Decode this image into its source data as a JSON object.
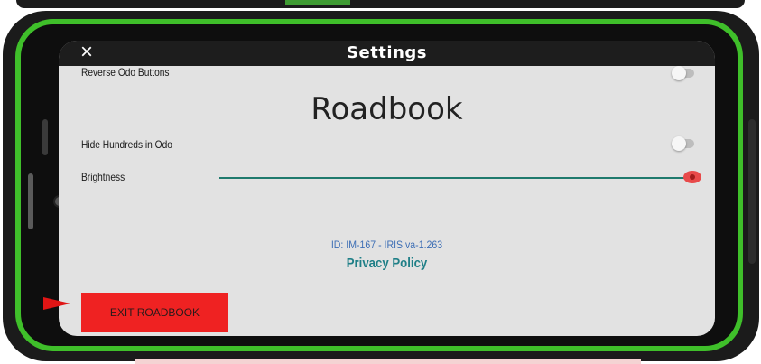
{
  "window": {
    "title": "Settings",
    "close_icon": "close-icon"
  },
  "settings": {
    "reverse_odo": {
      "label": "Reverse Odo Buttons",
      "enabled": false
    },
    "app_heading": "Roadbook",
    "hide_hundreds": {
      "label": "Hide Hundreds in Odo",
      "enabled": false
    },
    "brightness": {
      "label": "Brightness",
      "value_fraction": 1.0
    }
  },
  "footer": {
    "id_text": "ID: IM-167 - IRIS va-1.263",
    "privacy_link": "Privacy Policy",
    "exit_button": "EXIT ROADBOOK"
  },
  "colors": {
    "device_border": "#3fbf2a",
    "accent_teal": "#1f7a6d",
    "exit_red": "#ef2222",
    "slider_thumb": "#e84a4a",
    "id_blue": "#3e6fb5"
  }
}
